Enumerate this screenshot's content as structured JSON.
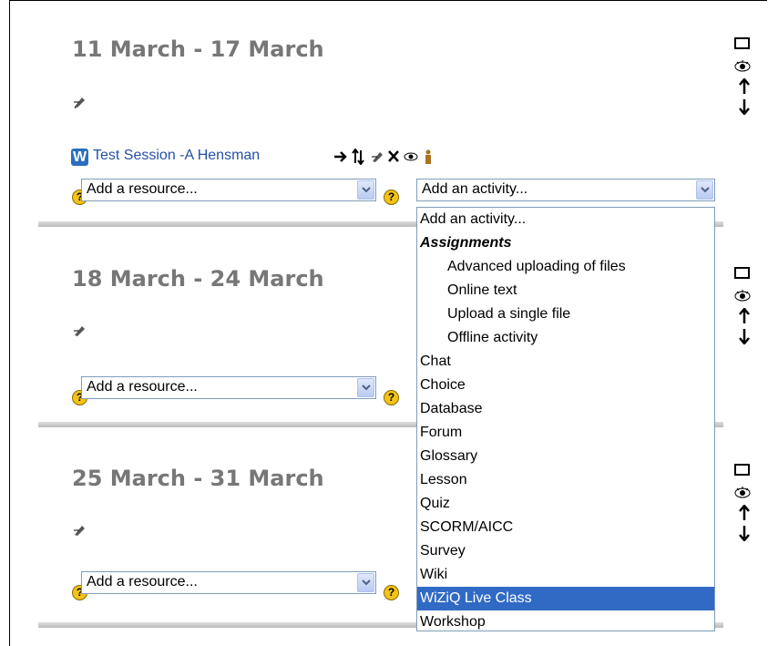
{
  "weeks": [
    {
      "title": "11 March - 17 March"
    },
    {
      "title": "18 March - 24 March"
    },
    {
      "title": "25 March - 31 March"
    }
  ],
  "session": {
    "icon_letter": "W",
    "link_text": "Test Session -A Hensman"
  },
  "resource_select": {
    "selected": "Add a resource..."
  },
  "activity_select": {
    "selected": "Add an activity..."
  },
  "help_icon_glyph": "?",
  "dropdown": {
    "items": [
      {
        "label": "Add an activity...",
        "type": "option"
      },
      {
        "label": "Assignments",
        "type": "group"
      },
      {
        "label": "Advanced uploading of files",
        "type": "suboption"
      },
      {
        "label": "Online text",
        "type": "suboption"
      },
      {
        "label": "Upload a single file",
        "type": "suboption"
      },
      {
        "label": "Offline activity",
        "type": "suboption"
      },
      {
        "label": "Chat",
        "type": "option"
      },
      {
        "label": "Choice",
        "type": "option"
      },
      {
        "label": "Database",
        "type": "option"
      },
      {
        "label": "Forum",
        "type": "option"
      },
      {
        "label": "Glossary",
        "type": "option"
      },
      {
        "label": "Lesson",
        "type": "option"
      },
      {
        "label": "Quiz",
        "type": "option"
      },
      {
        "label": "SCORM/AICC",
        "type": "option"
      },
      {
        "label": "Survey",
        "type": "option"
      },
      {
        "label": "Wiki",
        "type": "option"
      },
      {
        "label": "WiZiQ Live Class",
        "type": "option",
        "highlighted": true
      },
      {
        "label": "Workshop",
        "type": "option"
      }
    ]
  },
  "colors": {
    "week_title": "#777777",
    "link": "#2651a6",
    "highlight": "#316ac5",
    "help_icon": "#f2c318"
  }
}
